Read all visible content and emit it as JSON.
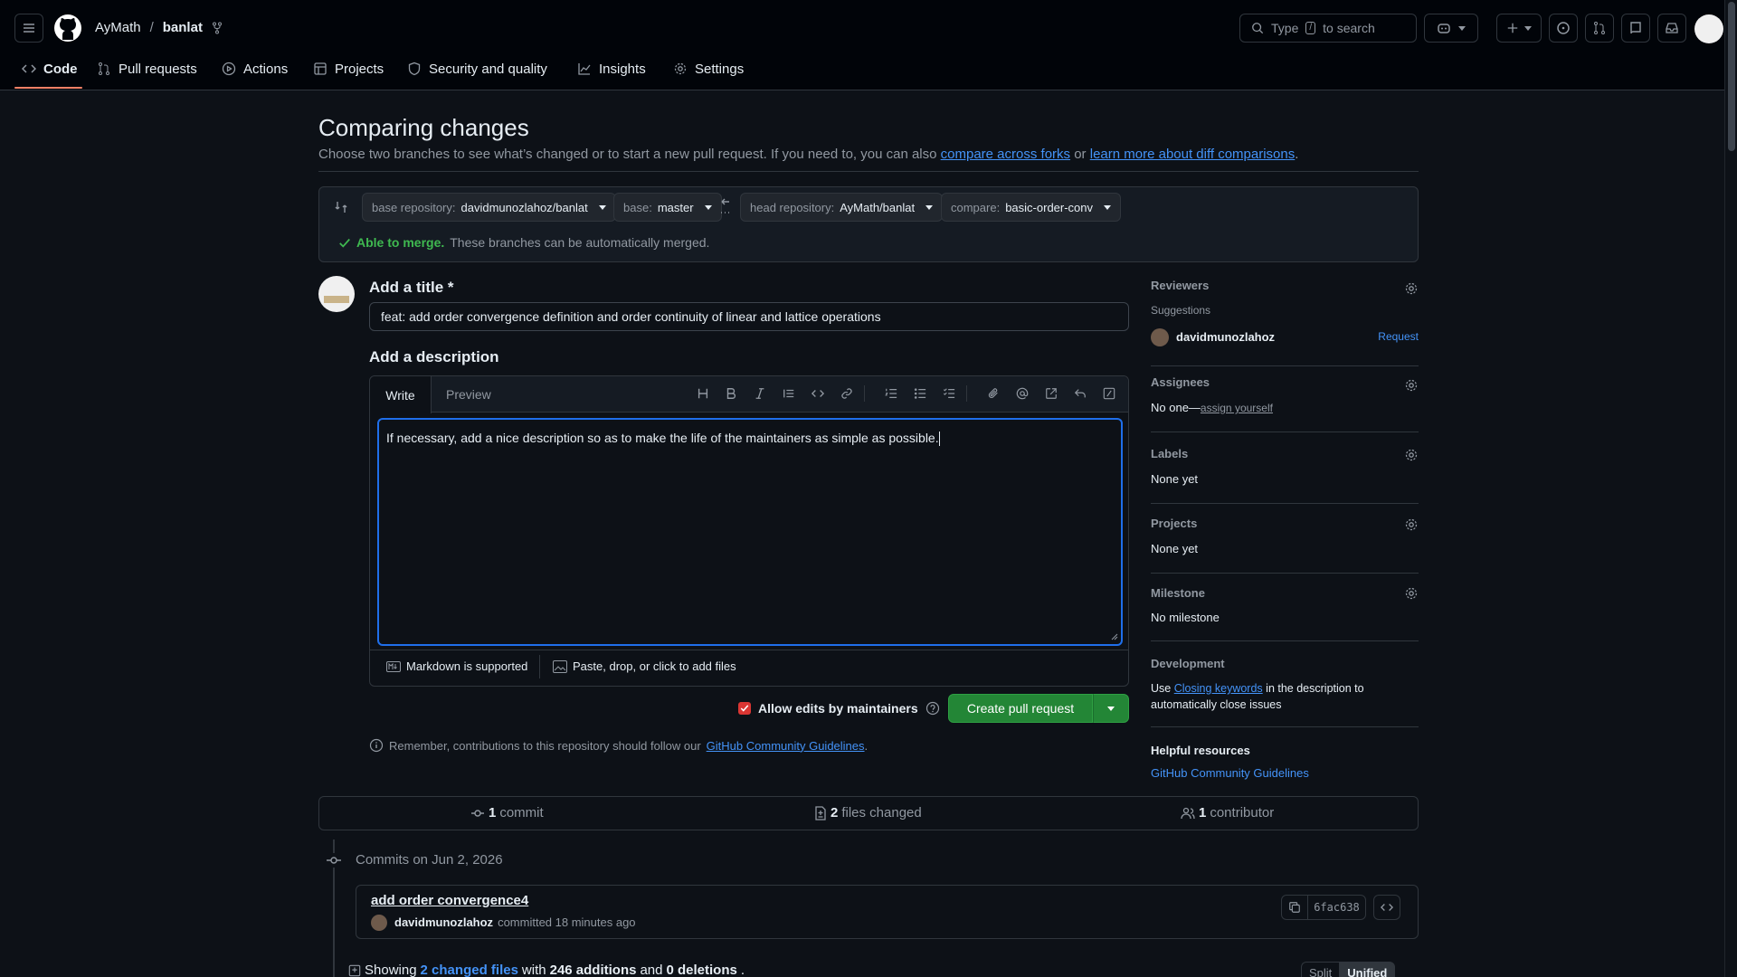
{
  "header": {
    "owner": "AyMath",
    "separator": "/",
    "repo": "banlat",
    "search_placeholder_pre": "Type",
    "search_key": "/",
    "search_placeholder_post": "to search"
  },
  "nav": {
    "tabs": [
      {
        "label": "Code",
        "icon": "code-icon",
        "active": true
      },
      {
        "label": "Pull requests",
        "icon": "pull-request-icon"
      },
      {
        "label": "Actions",
        "icon": "play-icon"
      },
      {
        "label": "Projects",
        "icon": "table-icon"
      },
      {
        "label": "Security and quality",
        "icon": "shield-icon"
      },
      {
        "label": "Insights",
        "icon": "graph-icon"
      },
      {
        "label": "Settings",
        "icon": "gear-icon"
      }
    ]
  },
  "compare": {
    "title": "Comparing changes",
    "subtitle_pre": "Choose two branches to see what’s changed or to start a new pull request. If you need to, you can also",
    "link_forks": "compare across forks",
    "subtitle_mid": "or",
    "link_learn": "learn more about diff comparisons",
    "subtitle_end": ".",
    "base_repo_label": "base repository:",
    "base_repo_value": "davidmunozlahoz/banlat",
    "base_label": "base:",
    "base_value": "master",
    "head_repo_label": "head repository:",
    "head_repo_value": "AyMath/banlat",
    "compare_label": "compare:",
    "compare_value": "basic-order-conv",
    "merge_status_bold": "Able to merge.",
    "merge_status_text": "These branches can be automatically merged."
  },
  "form": {
    "title_label": "Add a title *",
    "title_value": "feat: add order convergence definition and order continuity of linear and lattice operations",
    "desc_label": "Add a description",
    "tab_write": "Write",
    "tab_preview": "Preview",
    "desc_value": "If necessary, add a nice description so as to make the life of the maintainers as simple as possible.",
    "markdown_note": "Markdown is supported",
    "files_note": "Paste, drop, or click to add files",
    "allow_edits_label": "Allow edits by maintainers",
    "create_button": "Create pull request",
    "guidelines_pre": "Remember, contributions to this repository should follow our",
    "guidelines_link": "GitHub Community Guidelines",
    "guidelines_end": "."
  },
  "sidebar": {
    "reviewers_title": "Reviewers",
    "suggestions_label": "Suggestions",
    "suggested_user": "davidmunozlahoz",
    "request_label": "Request",
    "assignees_title": "Assignees",
    "assignees_none": "No one—",
    "assign_yourself": "assign yourself",
    "labels_title": "Labels",
    "labels_value": "None yet",
    "projects_title": "Projects",
    "projects_value": "None yet",
    "milestone_title": "Milestone",
    "milestone_value": "No milestone",
    "development_title": "Development",
    "development_pre": "Use",
    "development_link": "Closing keywords",
    "development_post": "in the description to automatically close issues",
    "helpful_title": "Helpful resources",
    "helpful_link": "GitHub Community Guidelines"
  },
  "summary": {
    "commits_count": "1",
    "commits_label": "commit",
    "files_count": "2",
    "files_label": "files changed",
    "contributors_count": "1",
    "contributors_label": "contributor"
  },
  "commits": {
    "group_title": "Commits on Jun 2, 2026",
    "commit_title": "add order convergence4",
    "author": "davidmunozlahoz",
    "committed_text": "committed 18 minutes ago",
    "sha": "6fac638"
  },
  "diff_summary": {
    "showing": "Showing",
    "changed_files": "2 changed files",
    "with": "with",
    "additions": "246 additions",
    "and": "and",
    "deletions": "0 deletions",
    "end": ".",
    "split": "Split",
    "unified": "Unified"
  },
  "colors": {
    "accent_link": "#4493f8",
    "success": "#3fb950",
    "button_green": "#238636",
    "tab_underline": "#f78166"
  }
}
